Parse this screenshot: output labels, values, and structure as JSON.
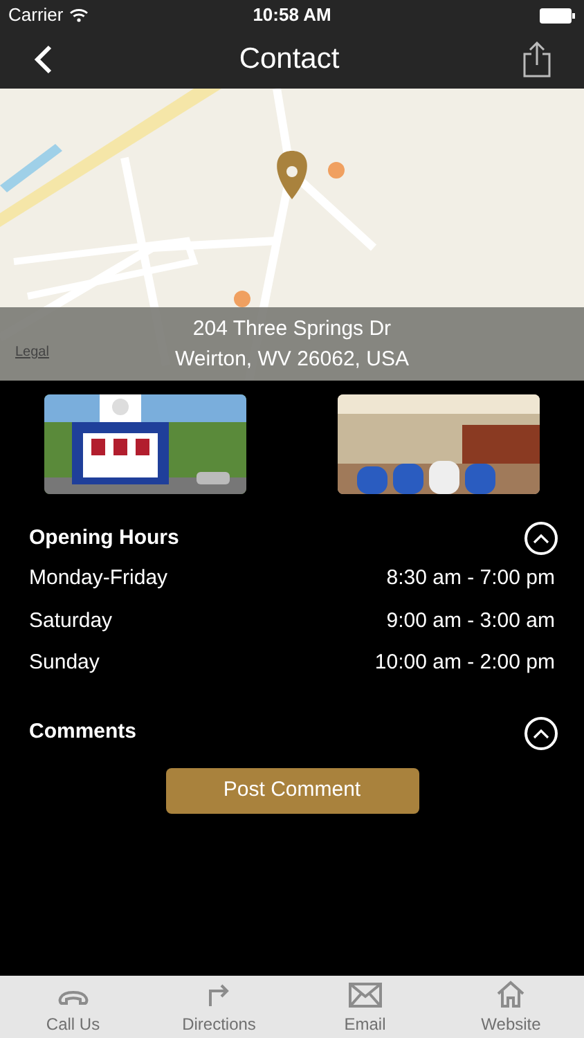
{
  "status_bar": {
    "carrier": "Carrier",
    "time": "10:58 AM"
  },
  "nav": {
    "title": "Contact"
  },
  "map": {
    "address_lines": [
      "204 Three Springs Dr",
      "Weirton, WV 26062, USA"
    ],
    "legal": "Legal"
  },
  "sections": [
    {
      "title": "Opening Hours",
      "expanded": true,
      "rows": [
        {
          "day": "Monday-Friday",
          "hours": "8:30 am - 7:00 pm"
        },
        {
          "day": "Saturday",
          "hours": "9:00 am - 3:00 am"
        },
        {
          "day": "Sunday",
          "hours": "10:00 am - 2:00 pm"
        }
      ]
    },
    {
      "title": "Comments",
      "expanded": true,
      "button": "Post Comment"
    }
  ],
  "tab_bar": [
    {
      "kind": "phone",
      "label": "Call Us"
    },
    {
      "kind": "directions",
      "label": "Directions"
    },
    {
      "kind": "email",
      "label": "Email"
    },
    {
      "kind": "home",
      "label": "Website"
    }
  ]
}
